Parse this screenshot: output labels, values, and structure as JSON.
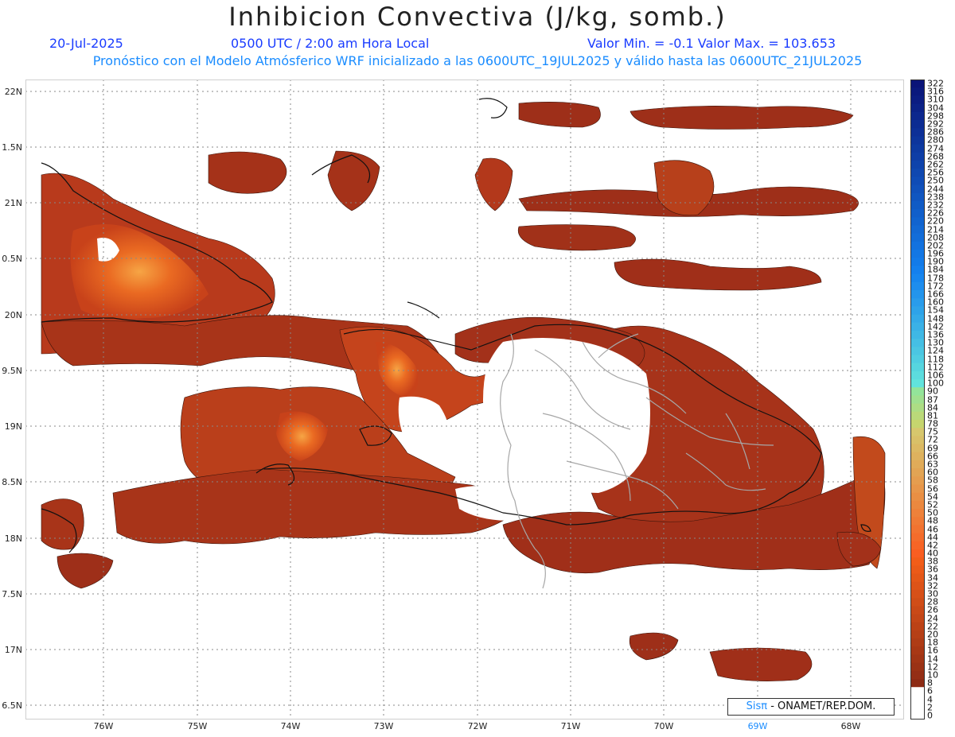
{
  "header": {
    "title": "Inhibicion Convectiva (J/kg, somb.)",
    "date": "20-Jul-2025",
    "time": "0500 UTC / 2:00 am Hora Local",
    "min_max": "Valor Min. = -0.1  Valor Max. = 103.653",
    "forecast_info": "Pronóstico con el Modelo Atmósferico WRF inicializado a las 0600UTC_19JUL2025 y válido hasta las  0600UTC_21JUL2025"
  },
  "axes": {
    "latitude_labels": [
      "22N",
      "1.5N",
      "21N",
      "0.5N",
      "20N",
      "9.5N",
      "19N",
      "8.5N",
      "18N",
      "7.5N",
      "17N",
      "6.5N"
    ],
    "latitude_values": [
      22,
      21.5,
      21,
      20.5,
      20,
      19.5,
      19,
      18.5,
      18,
      17.5,
      17,
      16.5
    ],
    "longitude_labels": [
      "76W",
      "75W",
      "74W",
      "73W",
      "72W",
      "71W",
      "70W",
      "69W",
      "68W"
    ],
    "longitude_values": [
      -76,
      -75,
      -74,
      -73,
      -72,
      -71,
      -70,
      -69,
      -68
    ],
    "longitude_highlight": "69W"
  },
  "colorbar": {
    "labels": [
      "322",
      "316",
      "310",
      "304",
      "298",
      "292",
      "286",
      "280",
      "274",
      "268",
      "262",
      "256",
      "250",
      "244",
      "238",
      "232",
      "226",
      "220",
      "214",
      "208",
      "202",
      "196",
      "190",
      "184",
      "178",
      "172",
      "166",
      "160",
      "154",
      "148",
      "142",
      "136",
      "130",
      "124",
      "118",
      "112",
      "106",
      "100",
      "90",
      "87",
      "84",
      "81",
      "78",
      "75",
      "72",
      "69",
      "66",
      "63",
      "60",
      "58",
      "56",
      "54",
      "52",
      "50",
      "48",
      "46",
      "44",
      "42",
      "40",
      "38",
      "36",
      "34",
      "32",
      "30",
      "28",
      "26",
      "24",
      "22",
      "20",
      "18",
      "16",
      "14",
      "12",
      "10",
      "8",
      "6",
      "4",
      "2",
      "0"
    ]
  },
  "credit": {
    "brand": "Sisπ",
    "text": " - ONAMET/REP.DOM."
  },
  "colors": {
    "cin_low": "#8b2d1e",
    "cin_mid": "#c8421a",
    "cin_high": "#f07020",
    "accent_blue": "#1a3cff",
    "accent_cyan": "#1a8cff"
  }
}
